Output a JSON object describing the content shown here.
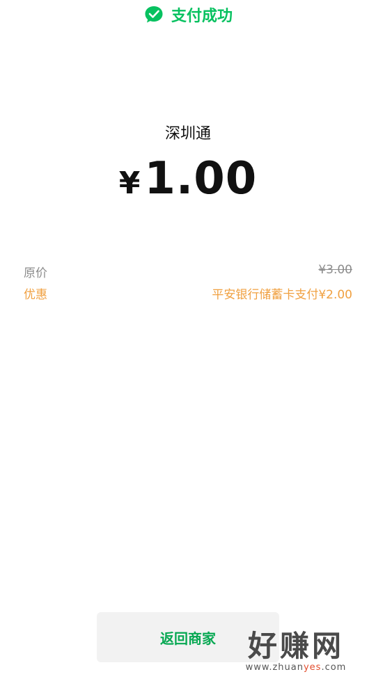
{
  "header": {
    "status_text": "支付成功",
    "icon": "wechat-pay-check-icon",
    "accent_color": "#07c160"
  },
  "payment": {
    "merchant": "深圳通",
    "currency_symbol": "¥",
    "amount": "1.00"
  },
  "details": {
    "original_label": "原价",
    "original_value": "¥3.00",
    "discount_label": "优惠",
    "discount_value": "平安银行储蓄卡支付¥2.00",
    "discount_color": "#f0a040"
  },
  "actions": {
    "return_label": "返回商家"
  },
  "watermark": {
    "title": "好赚网",
    "url_prefix": "www.zhuan",
    "url_highlight": "yes",
    "url_suffix": ".com"
  }
}
